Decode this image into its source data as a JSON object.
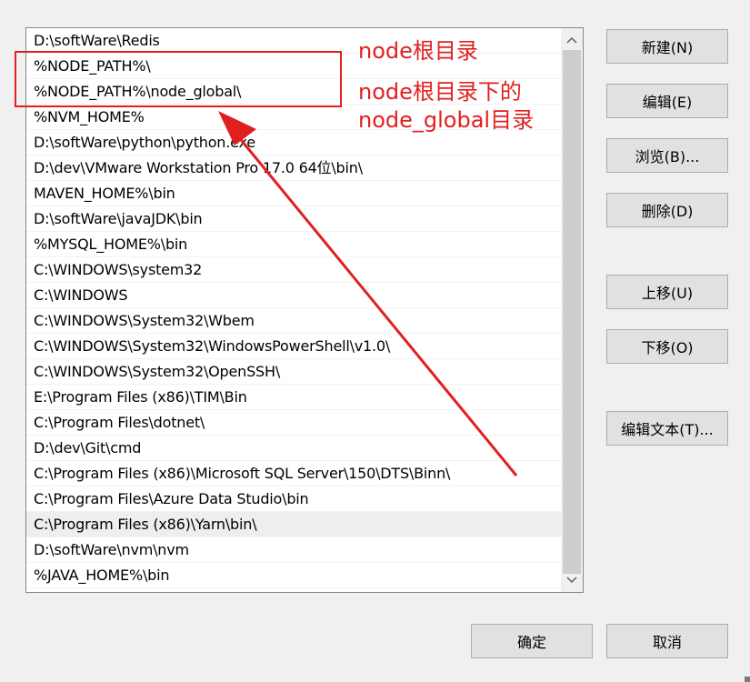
{
  "path_list": {
    "items": [
      "D:\\softWare\\Redis",
      "%NODE_PATH%\\",
      "%NODE_PATH%\\node_global\\",
      "%NVM_HOME%",
      "D:\\softWare\\python\\python.exe",
      "D:\\dev\\VMware Workstation Pro 17.0 64位\\bin\\",
      "MAVEN_HOME%\\bin",
      "D:\\softWare\\javaJDK\\bin",
      "%MYSQL_HOME%\\bin",
      "C:\\WINDOWS\\system32",
      "C:\\WINDOWS",
      "C:\\WINDOWS\\System32\\Wbem",
      "C:\\WINDOWS\\System32\\WindowsPowerShell\\v1.0\\",
      "C:\\WINDOWS\\System32\\OpenSSH\\",
      "E:\\Program Files (x86)\\TIM\\Bin",
      "C:\\Program Files\\dotnet\\",
      "D:\\dev\\Git\\cmd",
      "C:\\Program Files (x86)\\Microsoft SQL Server\\150\\DTS\\Binn\\",
      "C:\\Program Files\\Azure Data Studio\\bin",
      "C:\\Program Files (x86)\\Yarn\\bin\\",
      "D:\\softWare\\nvm\\nvm",
      "%JAVA_HOME%\\bin"
    ],
    "selected_index": 19
  },
  "buttons": {
    "new": "新建(N)",
    "edit": "编辑(E)",
    "browse": "浏览(B)...",
    "delete": "删除(D)",
    "move_up": "上移(U)",
    "move_down": "下移(O)",
    "edit_text": "编辑文本(T)...",
    "ok": "确定",
    "cancel": "取消"
  },
  "annotations": {
    "label_root": "node根目录",
    "label_global_line1": "node根目录下的",
    "label_global_line2": "node_global目录",
    "color": "#e21f1f"
  },
  "scrollbar": {
    "up_icon": "chevron-up-icon",
    "down_icon": "chevron-down-icon"
  }
}
